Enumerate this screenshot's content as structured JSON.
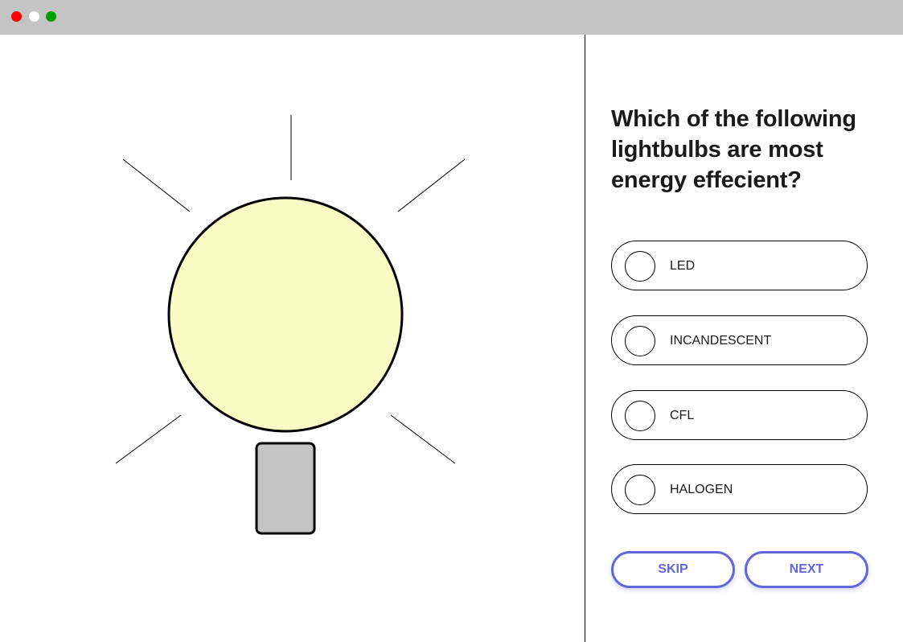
{
  "window": {
    "controls": [
      {
        "name": "close",
        "color": "#ff0000"
      },
      {
        "name": "minimize",
        "color": "#ffffff"
      },
      {
        "name": "maximize",
        "color": "#00a000"
      }
    ]
  },
  "illustration": {
    "icon": "lightbulb-icon",
    "bulb_color": "#fbfbc5",
    "base_color": "#c4c4c4"
  },
  "quiz": {
    "question": "Which of the following lightbulbs are most energy effecient?",
    "options": [
      {
        "label": "LED",
        "selected": false
      },
      {
        "label": "INCANDESCENT",
        "selected": false
      },
      {
        "label": "CFL",
        "selected": false
      },
      {
        "label": "HALOGEN",
        "selected": false
      }
    ],
    "buttons": {
      "skip": "SKIP",
      "next": "NEXT"
    },
    "accent_color": "#6366d9"
  }
}
